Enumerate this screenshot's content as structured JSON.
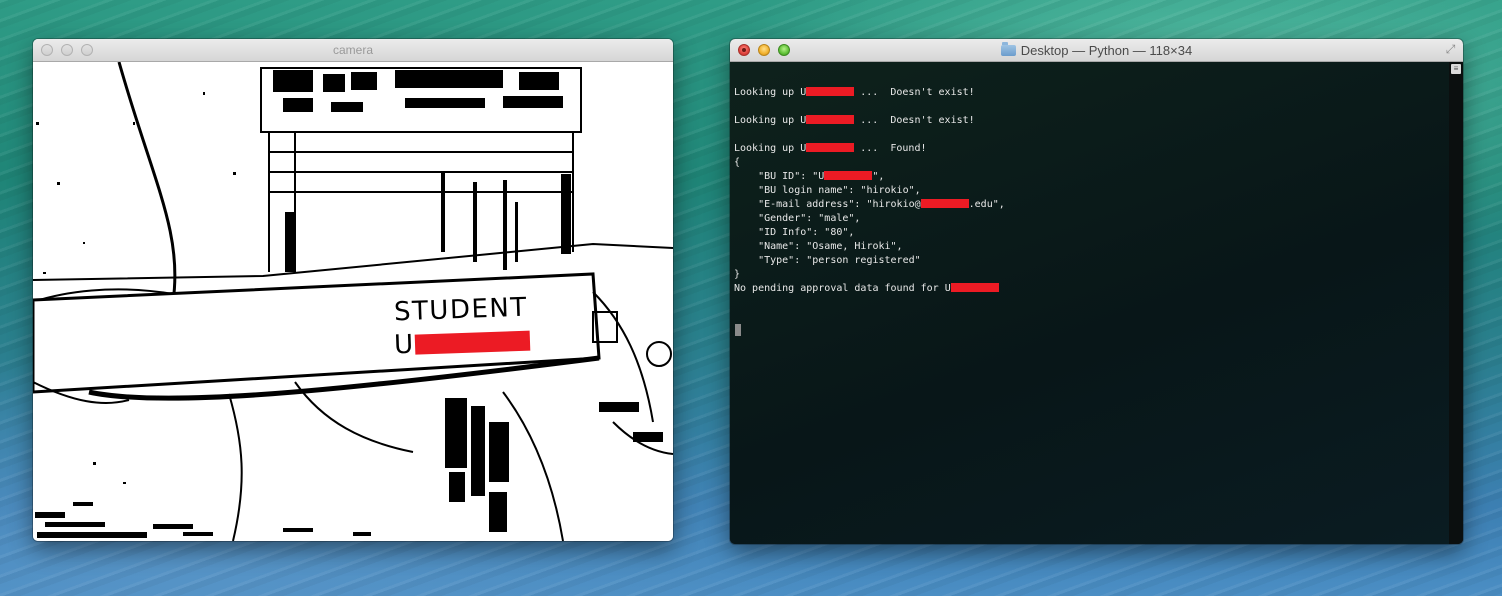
{
  "camera_window": {
    "title": "camera",
    "card_text_line1": "STUDENT",
    "card_text_line2_prefix": "U",
    "card_top_text": "UNIVERS"
  },
  "terminal_window": {
    "title": "Desktop — Python — 118×34",
    "lines": [
      {
        "pre": "",
        "redacted": false,
        "post": ""
      },
      {
        "pre": "Looking up U",
        "redacted": true,
        "post": " ...  Doesn't exist!"
      },
      {
        "pre": "",
        "redacted": false,
        "post": ""
      },
      {
        "pre": "Looking up U",
        "redacted": true,
        "post": " ...  Doesn't exist!"
      },
      {
        "pre": "",
        "redacted": false,
        "post": ""
      },
      {
        "pre": "Looking up U",
        "redacted": true,
        "post": " ...  Found!"
      },
      {
        "pre": "{",
        "redacted": false,
        "post": ""
      },
      {
        "pre": "    \"BU ID\": \"U",
        "redacted": true,
        "post": "\","
      },
      {
        "pre": "    \"BU login name\": \"hirokio\",",
        "redacted": false,
        "post": ""
      },
      {
        "pre": "    \"E-mail address\": \"hirokio@",
        "redacted": true,
        "post": ".edu\","
      },
      {
        "pre": "    \"Gender\": \"male\",",
        "redacted": false,
        "post": ""
      },
      {
        "pre": "    \"ID Info\": \"80\",",
        "redacted": false,
        "post": ""
      },
      {
        "pre": "    \"Name\": \"Osame, Hiroki\",",
        "redacted": false,
        "post": ""
      },
      {
        "pre": "    \"Type\": \"person registered\"",
        "redacted": false,
        "post": ""
      },
      {
        "pre": "}",
        "redacted": false,
        "post": ""
      },
      {
        "pre": "No pending approval data found for U",
        "redacted": true,
        "post": ""
      }
    ]
  },
  "colors": {
    "redaction": "#ec1b24",
    "terminal_text": "#e8e8e8",
    "terminal_bg": "#0e1614"
  },
  "icons": {
    "camera_traffic": [
      "close-icon",
      "minimize-icon",
      "zoom-icon"
    ],
    "terminal_title_icon": "folder-icon",
    "terminal_fullscreen": "fullscreen-icon"
  }
}
